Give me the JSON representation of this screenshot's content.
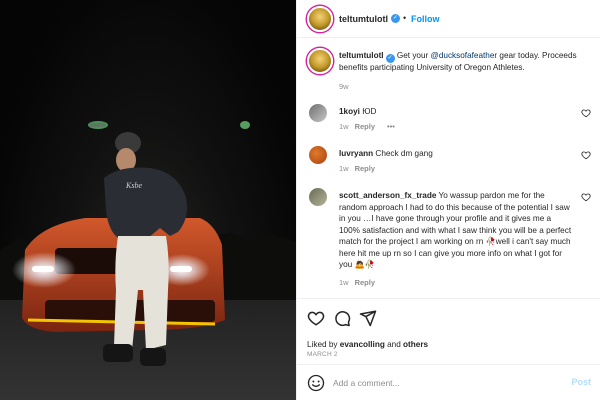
{
  "post": {
    "username": "teltumtulotl",
    "follow_label": "Follow",
    "more_label": "•••",
    "caption": {
      "username": "teltumtulotl",
      "text_before": " Get your ",
      "mention": "@ducksofafeather",
      "text_after": " gear today. Proceeds benefits participating University of Oregon Athletes.",
      "time": "9w"
    }
  },
  "comments": [
    {
      "username": "1koyi",
      "text": " ЮD ",
      "time": "1w",
      "reply": "Reply",
      "more": "•••"
    },
    {
      "username": "luvryann",
      "text": " Check dm gang",
      "time": "1w",
      "reply": "Reply"
    },
    {
      "username": "scott_anderson_fx_trade",
      "text": " Yo wassup pardon me for the random approach I had to do this because of the potential I saw in you …I have gone through your profile and it gives me a 100% satisfaction and with what I saw think you will be a perfect match for the project I am working on rn 🥀well i can't say much here hit me up rn so I can give you more info on what I got for you 🙇🥀",
      "time": "1w",
      "reply": "Reply"
    }
  ],
  "actions": {
    "liked_prefix": "Liked by ",
    "liked_user": "evancolling",
    "liked_mid": " and ",
    "liked_others": "others",
    "date": "MARCH 2"
  },
  "add_comment": {
    "placeholder": "Add a comment...",
    "post_label": "Post"
  },
  "icons": [
    "heart-icon",
    "comment-icon",
    "share-icon",
    "emoji-icon",
    "verified-icon"
  ],
  "colors": {
    "follow": "#0095f6",
    "verified": "#3897f0",
    "car": "#c8461e",
    "heart": "#ed4956"
  }
}
